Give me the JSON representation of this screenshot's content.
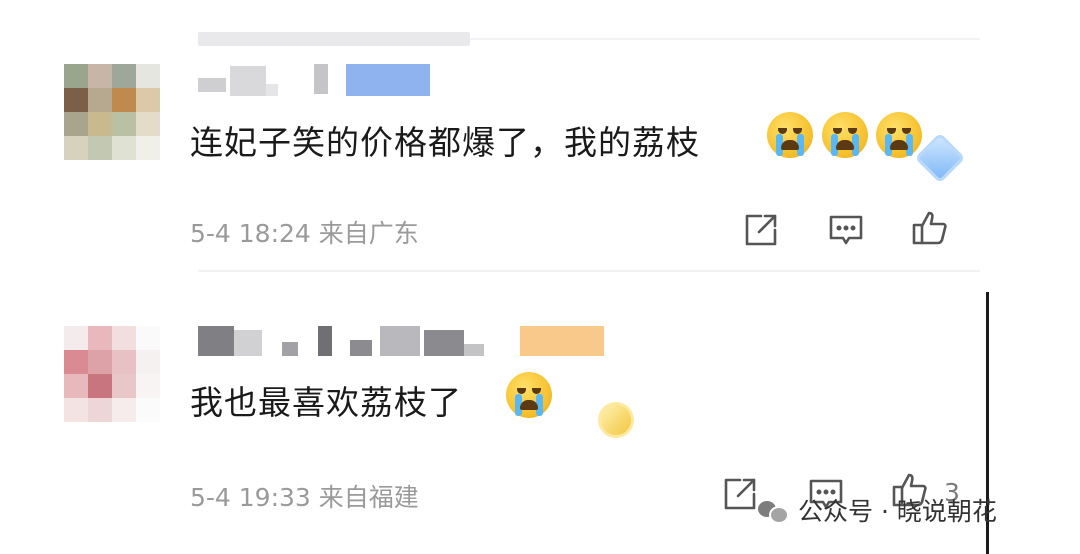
{
  "comments": [
    {
      "text": "连妃子笑的价格都爆了，我的荔枝",
      "emoji_names": [
        "crying-face-emoji",
        "crying-face-emoji",
        "crying-face-emoji"
      ],
      "badge_icon": "blue-diamond-badge-icon",
      "meta": "5-4 18:24 来自广东",
      "actions": {
        "share_icon": "share-icon",
        "comment_icon": "comment-icon",
        "like_icon": "thumbs-up-icon"
      },
      "like_count": ""
    },
    {
      "text": "我也最喜欢荔枝了",
      "emoji_names": [
        "crying-face-emoji"
      ],
      "badge_icon": "gold-badge-icon",
      "meta": "5-4 19:33 来自福建",
      "actions": {
        "share_icon": "share-icon",
        "comment_icon": "comment-icon",
        "like_icon": "thumbs-up-icon"
      },
      "like_count": "3"
    }
  ],
  "watermark": {
    "text": "公众号 · 晓说朝花",
    "icon": "wechat-icon"
  },
  "colors": {
    "meta_text": "#9a9a9a",
    "body_text": "#1a1a1a",
    "icon_stroke": "#555555"
  }
}
